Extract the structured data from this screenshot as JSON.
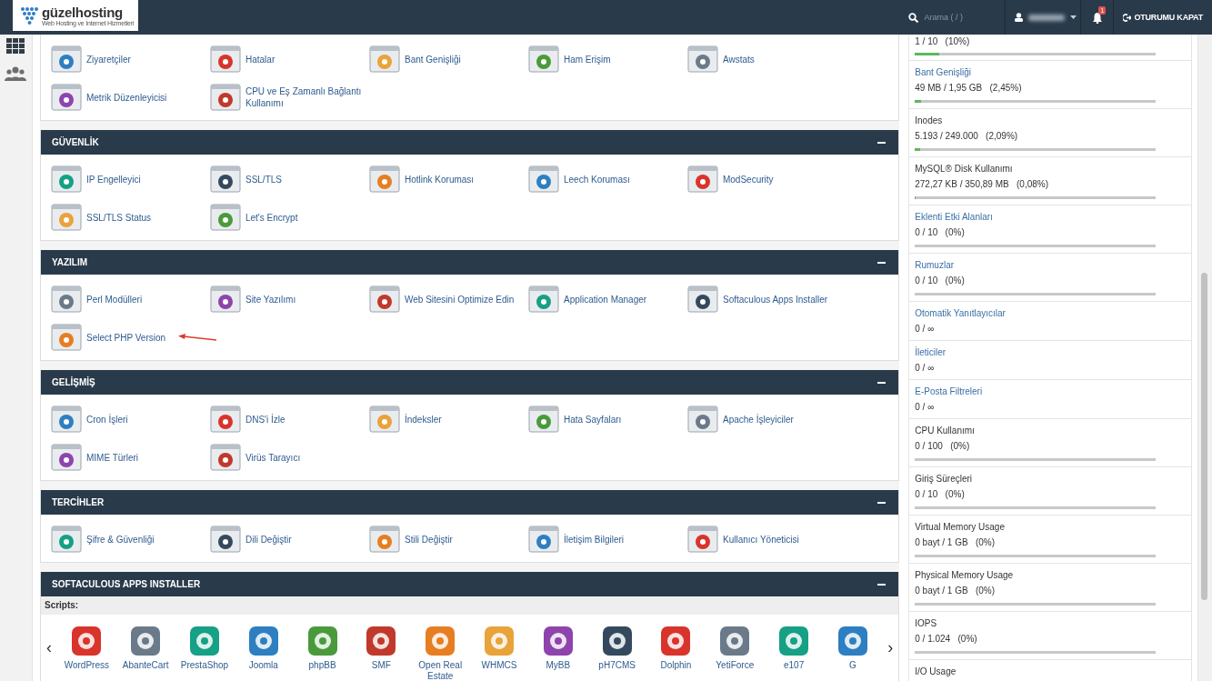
{
  "header": {
    "logo": "güzelhosting",
    "tagline": "Web Hosting ve İnternet Hizmetleri",
    "search": {
      "placeholder": "Arama ( / )"
    },
    "notification_count": "1",
    "logout": "OTURUMU KAPAT"
  },
  "sections": [
    {
      "items": [
        "Ziyaretçiler",
        "Hatalar",
        "Bant Genişliği",
        "Ham Erişim",
        "Awstats",
        "Metrik Düzenleyicisi",
        "CPU ve Eş Zamanlı Bağlantı Kullanımı"
      ]
    },
    {
      "title": "GÜVENLİK",
      "items": [
        "IP Engelleyici",
        "SSL/TLS",
        "Hotlink Koruması",
        "Leech Koruması",
        "ModSecurity",
        "SSL/TLS Status",
        "Let's Encrypt"
      ]
    },
    {
      "title": "YAZILIM",
      "items": [
        {
          "label": "Perl Modülleri",
          "annotated": false
        },
        {
          "label": "Site Yazılımı",
          "annotated": false
        },
        {
          "label": "Web Sitesini Optimize Edin",
          "annotated": false
        },
        {
          "label": "Application Manager",
          "annotated": false
        },
        {
          "label": "Softaculous Apps Installer",
          "annotated": false
        },
        {
          "label": "Select PHP Version",
          "annotated": true
        }
      ]
    },
    {
      "title": "GELİŞMİŞ",
      "items": [
        "Cron İşleri",
        "DNS'i İzle",
        "İndeksler",
        "Hata Sayfaları",
        "Apache İşleyiciler",
        "MIME Türleri",
        "Virüs Tarayıcı"
      ]
    },
    {
      "title": "TERCİHLER",
      "items": [
        "Şifre & Güvenliği",
        "Dili Değiştir",
        "Stili Değiştir",
        "İletişim Bilgileri",
        "Kullanıcı Yöneticisi"
      ]
    },
    {
      "title": "SOFTACULOUS APPS INSTALLER",
      "subheading": "Scripts:",
      "prev_arrow": "‹",
      "next_arrow": "›",
      "apps": [
        "WordPress",
        "AbanteCart",
        "PrestaShop",
        "Joomla",
        "phpBB",
        "SMF",
        "Open Real Estate",
        "WHMCS",
        "MyBB",
        "pH7CMS",
        "Dolphin",
        "YetiForce",
        "e107",
        "G"
      ]
    }
  ],
  "usage": [
    {
      "value": "1 / 10   (10%)",
      "level": 0.1
    },
    {
      "label": "Bant Genişliği",
      "link": true,
      "value": "49 MB / 1,95 GB   (2,45%)",
      "level": 0.0245
    },
    {
      "label": "Inodes",
      "link": false,
      "value": "5.193 / 249.000   (2,09%)",
      "level": 0.0209
    },
    {
      "label": "MySQL® Disk Kullanımı",
      "link": false,
      "value": "272,27 KB / 350,89 MB   (0,08%)",
      "level": 0.0008
    },
    {
      "label": "Eklenti Etki Alanları",
      "link": true,
      "value": "0 / 10   (0%)",
      "level": 0
    },
    {
      "label": "Rumuzlar",
      "link": true,
      "value": "0 / 10   (0%)",
      "level": 0
    },
    {
      "label": "Otomatik Yanıtlayıcılar",
      "link": true,
      "value": "0 / ∞"
    },
    {
      "label": "İleticiler",
      "link": true,
      "value": "0 / ∞"
    },
    {
      "label": "E-Posta Filtreleri",
      "link": true,
      "value": "0 / ∞"
    },
    {
      "label": "CPU Kullanımı",
      "link": false,
      "value": "0 / 100   (0%)",
      "level": 0
    },
    {
      "label": "Giriş Süreçleri",
      "link": false,
      "value": "0 / 10   (0%)",
      "level": 0
    },
    {
      "label": "Virtual Memory Usage",
      "link": false,
      "value": "0 bayt / 1 GB   (0%)",
      "level": 0
    },
    {
      "label": "Physical Memory Usage",
      "link": false,
      "value": "0 bayt / 1 GB   (0%)",
      "level": 0
    },
    {
      "label": "IOPS",
      "link": false,
      "value": "0 / 1.024   (0%)",
      "level": 0
    },
    {
      "label": "I/O Usage",
      "link": false
    }
  ]
}
